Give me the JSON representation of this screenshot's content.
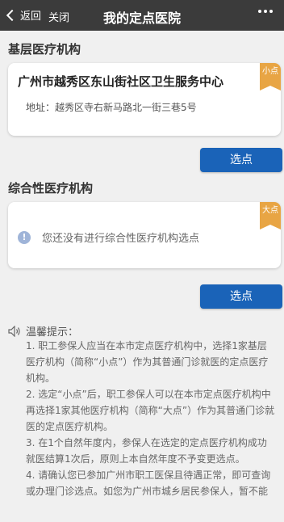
{
  "header": {
    "back_label": "返回",
    "close_label": "关闭",
    "title": "我的定点医院"
  },
  "basic": {
    "section_label": "基层医疗机构",
    "tag": "小点",
    "hospital_name": "广州市越秀区东山街社区卫生服务中心",
    "address": "地址：越秀区寺右新马路北一街三巷5号",
    "button_label": "选点"
  },
  "general": {
    "section_label": "综合性医疗机构",
    "tag": "大点",
    "empty_message": "您还没有进行综合性医疗机构选点",
    "button_label": "选点"
  },
  "tips": {
    "title": "温馨提示：",
    "items": [
      "1. 职工参保人应当在本市定点医疗机构中，选择1家基层医疗机构（简称“小点”）作为其普通门诊就医的定点医疗机构。",
      "2. 选定“小点”后，职工参保人可以在本市定点医疗机构中再选择1家其他医疗机构（简称“大点”）作为其普通门诊就医的定点医疗机构。",
      "3. 在1个自然年度内，参保人在选定的定点医疗机构成功就医结算1次后，原则上本自然年度不予变更选点。",
      "4. 请确认您已参加广州市职工医保且待遇正常，即可查询或办理门诊选点。如您为广州市城乡居民参保人，暂不能"
    ]
  },
  "colors": {
    "topbar": "#3b3b3b",
    "button": "#1a63b8",
    "tag": "#e8a544",
    "info_icon": "#9fb4d8"
  }
}
